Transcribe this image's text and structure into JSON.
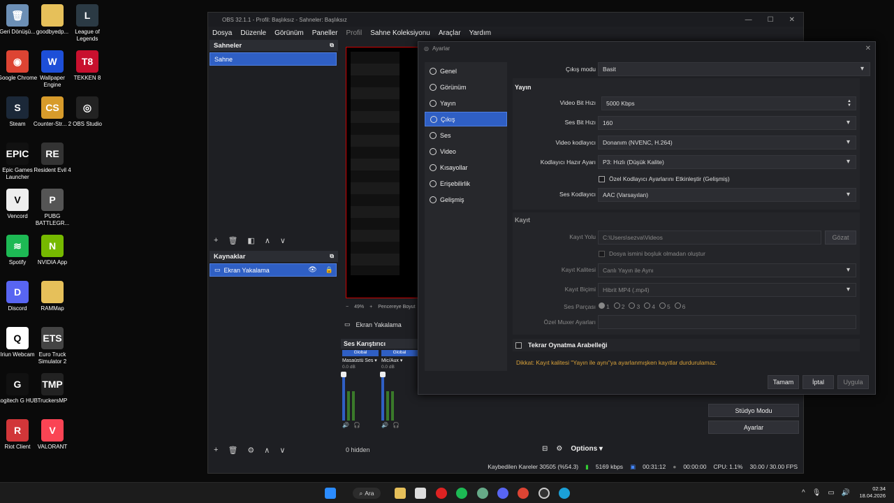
{
  "desktop": {
    "icons": [
      {
        "label": "Geri Dönüşü...",
        "col": 0,
        "row": 0,
        "color": "#6c8fb5",
        "glyph": "🗑",
        "icon": "recycle-bin-icon"
      },
      {
        "label": "goodbyedp...",
        "col": 1,
        "row": 0,
        "color": "#e6c05a",
        "glyph": "",
        "icon": "folder-icon"
      },
      {
        "label": "League of Legends",
        "col": 2,
        "row": 0,
        "color": "#2b3a44",
        "glyph": "L",
        "icon": "league-icon"
      },
      {
        "label": "Google Chrome",
        "col": 0,
        "row": 1,
        "color": "#dd4433",
        "glyph": "◉",
        "icon": "chrome-icon"
      },
      {
        "label": "Wallpaper Engine",
        "col": 1,
        "row": 1,
        "color": "#1d4fd8",
        "glyph": "W",
        "icon": "wallpaper-engine-icon"
      },
      {
        "label": "TEKKEN 8",
        "col": 2,
        "row": 1,
        "color": "#c8102e",
        "glyph": "T8",
        "icon": "tekken-icon"
      },
      {
        "label": "Steam",
        "col": 0,
        "row": 2,
        "color": "#1b2838",
        "glyph": "S",
        "icon": "steam-icon"
      },
      {
        "label": "Counter-Str... 2",
        "col": 1,
        "row": 2,
        "color": "#d79b2b",
        "glyph": "CS",
        "icon": "cs2-icon"
      },
      {
        "label": "OBS Studio",
        "col": 2,
        "row": 2,
        "color": "#222",
        "glyph": "◎",
        "icon": "obs-icon"
      },
      {
        "label": "Epic Games Launcher",
        "col": 0,
        "row": 3,
        "color": "#111",
        "glyph": "EPIC",
        "icon": "epic-icon"
      },
      {
        "label": "Resident Evil 4",
        "col": 1,
        "row": 3,
        "color": "#333",
        "glyph": "RE",
        "icon": "re4-icon"
      },
      {
        "label": "Vencord",
        "col": 0,
        "row": 4,
        "color": "#eee",
        "glyph": "V",
        "icon": "vencord-icon"
      },
      {
        "label": "PUBG BATTLEGR...",
        "col": 1,
        "row": 4,
        "color": "#555",
        "glyph": "P",
        "icon": "pubg-icon"
      },
      {
        "label": "Spotify",
        "col": 0,
        "row": 5,
        "color": "#1db954",
        "glyph": "≋",
        "icon": "spotify-icon"
      },
      {
        "label": "NVIDIA App",
        "col": 1,
        "row": 5,
        "color": "#76b900",
        "glyph": "N",
        "icon": "nvidia-icon"
      },
      {
        "label": "Discord",
        "col": 0,
        "row": 6,
        "color": "#5865f2",
        "glyph": "D",
        "icon": "discord-icon"
      },
      {
        "label": "RAMMap",
        "col": 1,
        "row": 6,
        "color": "#e6c05a",
        "glyph": "",
        "icon": "folder-icon"
      },
      {
        "label": "Iriun Webcam",
        "col": 0,
        "row": 7,
        "color": "#fff",
        "glyph": "Q",
        "icon": "iriun-icon"
      },
      {
        "label": "Euro Truck Simulator 2",
        "col": 1,
        "row": 7,
        "color": "#444",
        "glyph": "ETS",
        "icon": "ets2-icon"
      },
      {
        "label": "Logitech G HUB",
        "col": 0,
        "row": 8,
        "color": "#111",
        "glyph": "G",
        "icon": "ghub-icon"
      },
      {
        "label": "TruckersMP",
        "col": 1,
        "row": 8,
        "color": "#222",
        "glyph": "TMP",
        "icon": "truckersmp-icon"
      },
      {
        "label": "Riot Client",
        "col": 0,
        "row": 9,
        "color": "#d13639",
        "glyph": "R",
        "icon": "riot-icon"
      },
      {
        "label": "VALORANT",
        "col": 1,
        "row": 9,
        "color": "#fa4454",
        "glyph": "V",
        "icon": "valorant-icon"
      }
    ]
  },
  "obs": {
    "title": "OBS 32.1.1 - Profil: Başlıksız - Sahneler: Başlıksız",
    "menu": [
      "Dosya",
      "Düzenle",
      "Görünüm",
      "Paneller",
      "Profil",
      "Sahne Koleksiyonu",
      "Araçlar",
      "Yardım"
    ],
    "scenes_title": "Sahneler",
    "scene_item": "Sahne",
    "sources_title": "Kaynaklar",
    "source_item": "Ekran Yakalama",
    "preview_zoom": "49%",
    "preview_fit": "Pencereye Boyut",
    "source_bar_label": "Ekran Yakalama",
    "mixer_title": "Ses Karıştırıcı",
    "mixer": [
      {
        "tag": "Global",
        "name": "Masaüstü Ses",
        "db": "0.0 dB"
      },
      {
        "tag": "Global",
        "name": "Mic/Aux",
        "db": "0.0 dB"
      }
    ],
    "hidden_label": "0 hidden",
    "options_label": "Options",
    "controls": {
      "partial": "",
      "studio": "Stüdyo Modu",
      "settings": "Ayarlar"
    },
    "status": {
      "dropped": "Kaybedilen Kareler 30505 (%54.3)",
      "bitrate": "5169 kbps",
      "stream_time": "00:31:12",
      "rec_time": "00:00:00",
      "cpu": "CPU: 1.1%",
      "fps": "30.00 / 30.00 FPS"
    }
  },
  "settings": {
    "title": "Ayarlar",
    "nav": [
      "Genel",
      "Görünüm",
      "Yayın",
      "Çıkış",
      "Ses",
      "Video",
      "Kısayollar",
      "Erişebilirlik",
      "Gelişmiş"
    ],
    "selected_nav": "Çıkış",
    "output_mode_label": "Çıkış modu",
    "output_mode": "Basit",
    "stream_section": "Yayın",
    "video_bitrate_label": "Video Bit Hızı",
    "video_bitrate": "5000 Kbps",
    "audio_bitrate_label": "Ses Bit Hızı",
    "audio_bitrate": "160",
    "video_encoder_label": "Video kodlayıcı",
    "video_encoder": "Donanım (NVENC, H.264)",
    "preset_label": "Kodlayıcı Hazır Ayarı",
    "preset": "P3: Hızlı (Düşük Kalite)",
    "custom_encoder_label": "Özel Kodlayıcı Ayarlarını Etkinleştir (Gelişmiş)",
    "audio_encoder_label": "Ses Kodlayıcı",
    "audio_encoder": "AAC (Varsayılan)",
    "record_section": "Kayıt",
    "rec_path_label": "Kayıt Yolu",
    "rec_path": "C:\\Users\\sezva\\Videos",
    "browse": "Gözat",
    "no_space_label": "Dosya ismini boşluk olmadan oluştur",
    "rec_quality_label": "Kayıt Kalitesi",
    "rec_quality": "Canlı Yayın ile Aynı",
    "rec_format_label": "Kayıt Biçimi",
    "rec_format": "Hibrit MP4 (.mp4)",
    "audio_track_label": "Ses Parçası",
    "tracks": [
      "1",
      "2",
      "3",
      "4",
      "5",
      "6"
    ],
    "muxer_label": "Özel Muxer Ayarları",
    "replay_label": "Tekrar Oynatma Arabelleği",
    "warning": "Dikkat: Kayıt kalitesi \"Yayın ile aynı\"ya ayarlanmışken kayıtlar durdurulamaz.",
    "ok": "Tamam",
    "cancel": "İptal",
    "apply": "Uygula"
  },
  "taskbar": {
    "search": "Ara",
    "time": "02:34",
    "date": "18.04.2026"
  }
}
